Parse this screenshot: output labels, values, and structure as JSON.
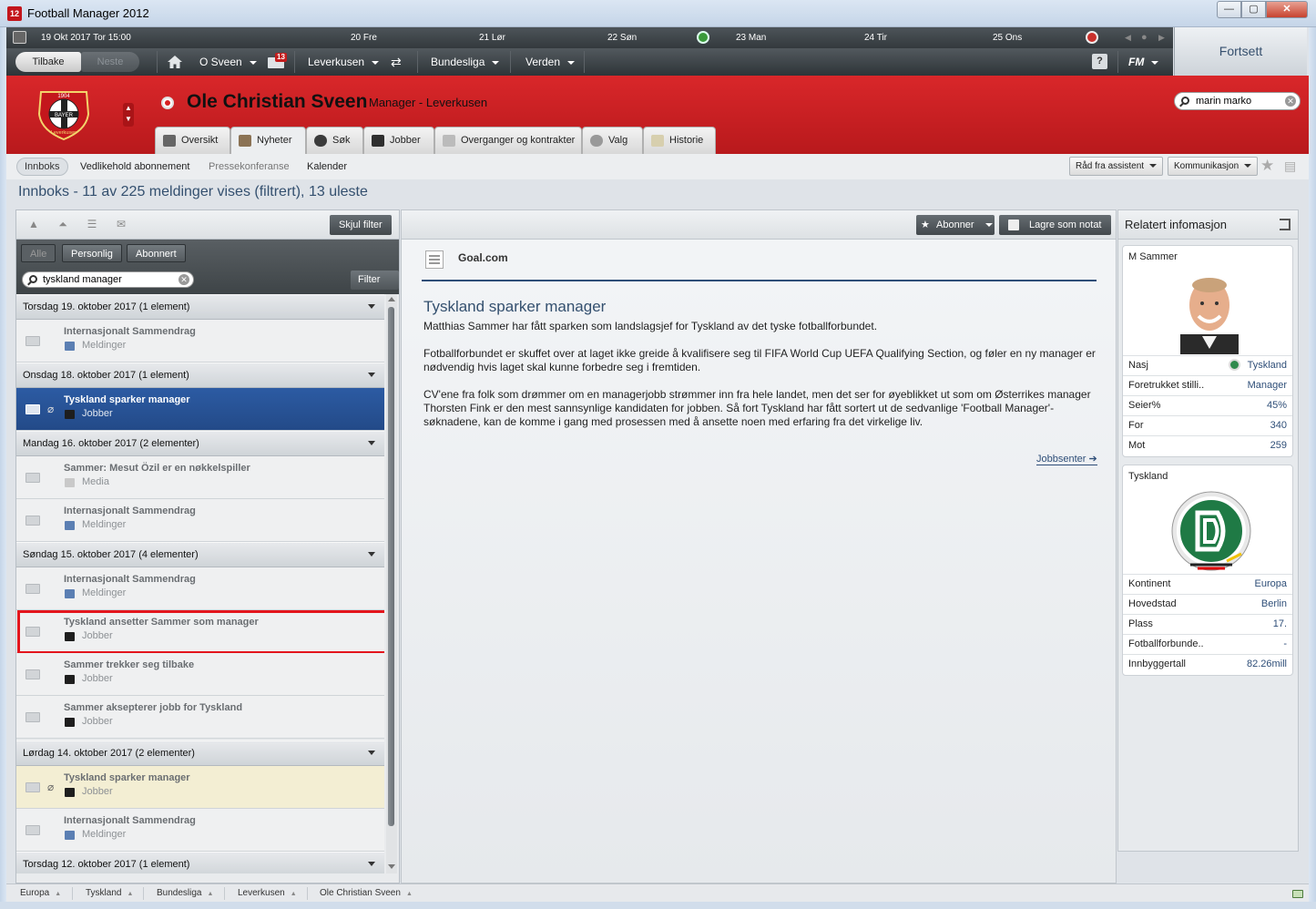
{
  "window": {
    "title": "Football Manager 2012",
    "app_icon_text": "12",
    "minimize": "—",
    "maximize": "▢",
    "close": "✕"
  },
  "calendar": {
    "current": "19 Okt 2017  Tor  15:00",
    "days": [
      "20  Fre",
      "21  Lør",
      "22  Søn",
      "23  Man",
      "24  Tir",
      "25  Ons"
    ]
  },
  "nav": {
    "back": "Tilbake",
    "next": "Neste",
    "manager": "O Sveen",
    "inbox_count": "13",
    "club": "Leverkusen",
    "league": "Bundesliga",
    "world": "Verden",
    "help": "?",
    "fm": "FM"
  },
  "continue_label": "Fortsett",
  "header": {
    "manager_name": "Ole Christian Sveen",
    "role": "Manager - Leverkusen",
    "search_value": "marin marko",
    "crest_text_top": "1904",
    "crest_text_mid": "BAYER",
    "crest_text_bottom": "Leverkusen"
  },
  "tabs": [
    {
      "label": "Oversikt"
    },
    {
      "label": "Nyheter"
    },
    {
      "label": "Søk"
    },
    {
      "label": "Jobber"
    },
    {
      "label": "Overganger og kontrakter"
    },
    {
      "label": "Valg"
    },
    {
      "label": "Historie"
    }
  ],
  "subtabs": [
    "Innboks",
    "Vedlikehold abonnement",
    "Pressekonferanse",
    "Kalender"
  ],
  "subtab_buttons": {
    "assistant": "Råd fra assistent",
    "communication": "Kommunikasjon"
  },
  "inbox_heading": "Innboks - 11 av 225 meldinger vises (filtrert), 13 uleste",
  "left": {
    "hide_filter": "Skjul filter",
    "filter_tabs": [
      "Alle",
      "Personlig",
      "Abonnert"
    ],
    "search_value": "tyskland manager",
    "filter_btn": "Filter",
    "groups": [
      {
        "label": "Torsdag 19. oktober 2017 (1 element)",
        "messages": [
          {
            "title": "Internasjonalt Sammendrag",
            "category": "Meldinger"
          }
        ]
      },
      {
        "label": "Onsdag 18. oktober 2017 (1 element)",
        "messages": [
          {
            "title": "Tyskland sparker manager",
            "category": "Jobber"
          }
        ]
      },
      {
        "label": "Mandag 16. oktober 2017 (2 elementer)",
        "messages": [
          {
            "title": "Sammer: Mesut Özil er en nøkkelspiller",
            "category": "Media"
          },
          {
            "title": "Internasjonalt Sammendrag",
            "category": "Meldinger"
          }
        ]
      },
      {
        "label": "Søndag 15. oktober 2017 (4 elementer)",
        "messages": [
          {
            "title": "Internasjonalt Sammendrag",
            "category": "Meldinger"
          },
          {
            "title": "Tyskland ansetter Sammer som manager",
            "category": "Jobber"
          },
          {
            "title": "Sammer trekker seg tilbake",
            "category": "Jobber"
          },
          {
            "title": "Sammer aksepterer jobb for Tyskland",
            "category": "Jobber"
          }
        ]
      },
      {
        "label": "Lørdag 14. oktober 2017 (2 elementer)",
        "messages": [
          {
            "title": "Tyskland sparker manager",
            "category": "Jobber"
          },
          {
            "title": "Internasjonalt Sammendrag",
            "category": "Meldinger"
          }
        ]
      },
      {
        "label": "Torsdag 12. oktober 2017 (1 element)",
        "messages": []
      }
    ]
  },
  "center": {
    "subscribe": "Abonner",
    "save_note": "Lagre som notat",
    "source": "Goal.com",
    "title": "Tyskland sparker manager",
    "paragraphs": [
      "Matthias Sammer har fått sparken som landslagsjef for Tyskland av det tyske fotballforbundet.",
      "Fotballforbundet er skuffet over at laget ikke greide å kvalifisere seg til FIFA World Cup UEFA Qualifying Section, og føler en ny manager er nødvendig hvis laget skal kunne forbedre seg i fremtiden.",
      "CV'ene fra folk som drømmer om en managerjobb strømmer inn fra hele landet, men det ser for øyeblikket ut som om Østerrikes manager Thorsten Fink er den mest sannsynlige kandidaten for jobben. Så fort Tyskland har fått sortert ut de sedvanlige 'Football Manager'-søknadene, kan de komme i gang med prosessen med å ansette noen med erfaring fra det virkelige liv."
    ],
    "link": "Jobbsenter"
  },
  "right": {
    "heading": "Relatert infomasjon",
    "person": {
      "name": "M Sammer",
      "rows": [
        {
          "k": "Nasj",
          "v": "Tyskland"
        },
        {
          "k": "Foretrukket stilli..",
          "v": "Manager"
        },
        {
          "k": "Seier%",
          "v": "45%"
        },
        {
          "k": "For",
          "v": "340"
        },
        {
          "k": "Mot",
          "v": "259"
        }
      ]
    },
    "nation": {
      "name": "Tyskland",
      "rows": [
        {
          "k": "Kontinent",
          "v": "Europa"
        },
        {
          "k": "Hovedstad",
          "v": "Berlin"
        },
        {
          "k": "Plass",
          "v": "17."
        },
        {
          "k": "Fotballforbunde..",
          "v": "-"
        },
        {
          "k": "Innbyggertall",
          "v": "82.26mill"
        }
      ]
    }
  },
  "bottom_crumbs": [
    "Europa",
    "Tyskland",
    "Bundesliga",
    "Leverkusen",
    "Ole Christian Sveen"
  ],
  "colors": {
    "header_red": "#c8202a",
    "selected_blue": "#2c5ba3",
    "title_blue": "#34506f",
    "annotation_red": "#e3151d"
  }
}
